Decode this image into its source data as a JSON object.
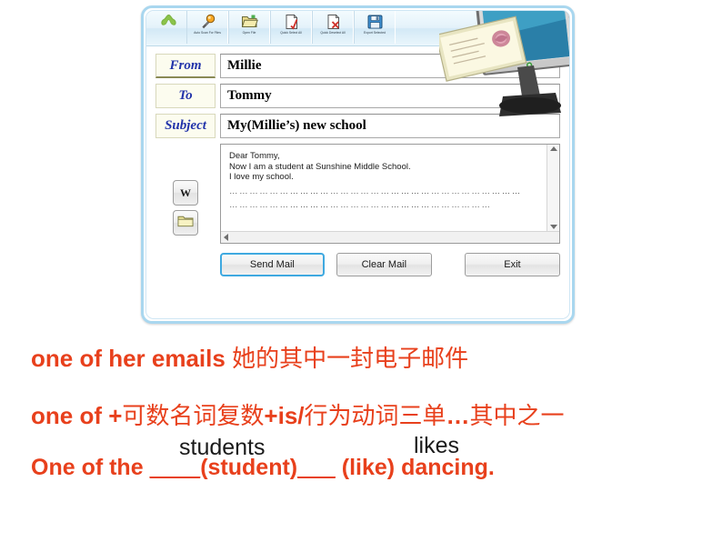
{
  "window": {
    "accent_border": "#a9d7ef",
    "toolbar": {
      "buttons": [
        {
          "name": "app-logo",
          "label": "",
          "icon": "logo-icon"
        },
        {
          "name": "auto-scan-for-files",
          "label": "Auto Scan For Files",
          "icon": "magnifier-icon"
        },
        {
          "name": "open-file",
          "label": "Open File",
          "icon": "open-folder-icon"
        },
        {
          "name": "quick-select-all",
          "label": "Quick Select All",
          "icon": "document-check-icon"
        },
        {
          "name": "quick-deselect-all",
          "label": "Quick Deselect All",
          "icon": "document-cross-icon"
        },
        {
          "name": "export-selected",
          "label": "Export Selected",
          "icon": "floppy-save-icon"
        }
      ]
    },
    "fields": [
      {
        "label": "From",
        "value": "Millie"
      },
      {
        "label": "To",
        "value": "Tommy"
      },
      {
        "label": "Subject",
        "value": "My(Millie’s) new school"
      }
    ],
    "side_buttons": [
      {
        "name": "attach-word-document",
        "glyph": "W"
      },
      {
        "name": "attach-folder",
        "glyph": "folder-icon"
      }
    ],
    "message": {
      "lines": [
        "Dear Tommy,",
        "Now I am a student at Sunshine Middle School.",
        "I love my school."
      ],
      "dotted_line_1": "……………………………………………………………………………",
      "dotted_line_2": "……………………………………………………………………"
    },
    "actions": {
      "send": "Send Mail",
      "clear": "Clear Mail",
      "exit": "Exit"
    }
  },
  "illustration": {
    "name": "monitor-with-flying-envelope",
    "screen_color": "#3e9fc4",
    "stamp_color": "#c4738c"
  },
  "annotations": {
    "color": "#e8401c",
    "answer_color": "#1a1a1a",
    "line1_en": "one of her emails ",
    "line1_cn": "她的其中一封电子邮件",
    "line2_en_a": "one of +",
    "line2_cn_a": "可数名词复数",
    "line2_en_b": "+is/",
    "line2_cn_b": "行为动词三单",
    "line2_en_c": "…",
    "line2_cn_c": "其中之一",
    "line3_a": "One of the ",
    "line3_blank1": "____",
    "line3_b": "(student)",
    "line3_blank2": "___",
    "line3_c": " (like) dancing.",
    "answer1": "students",
    "answer2": "likes"
  }
}
